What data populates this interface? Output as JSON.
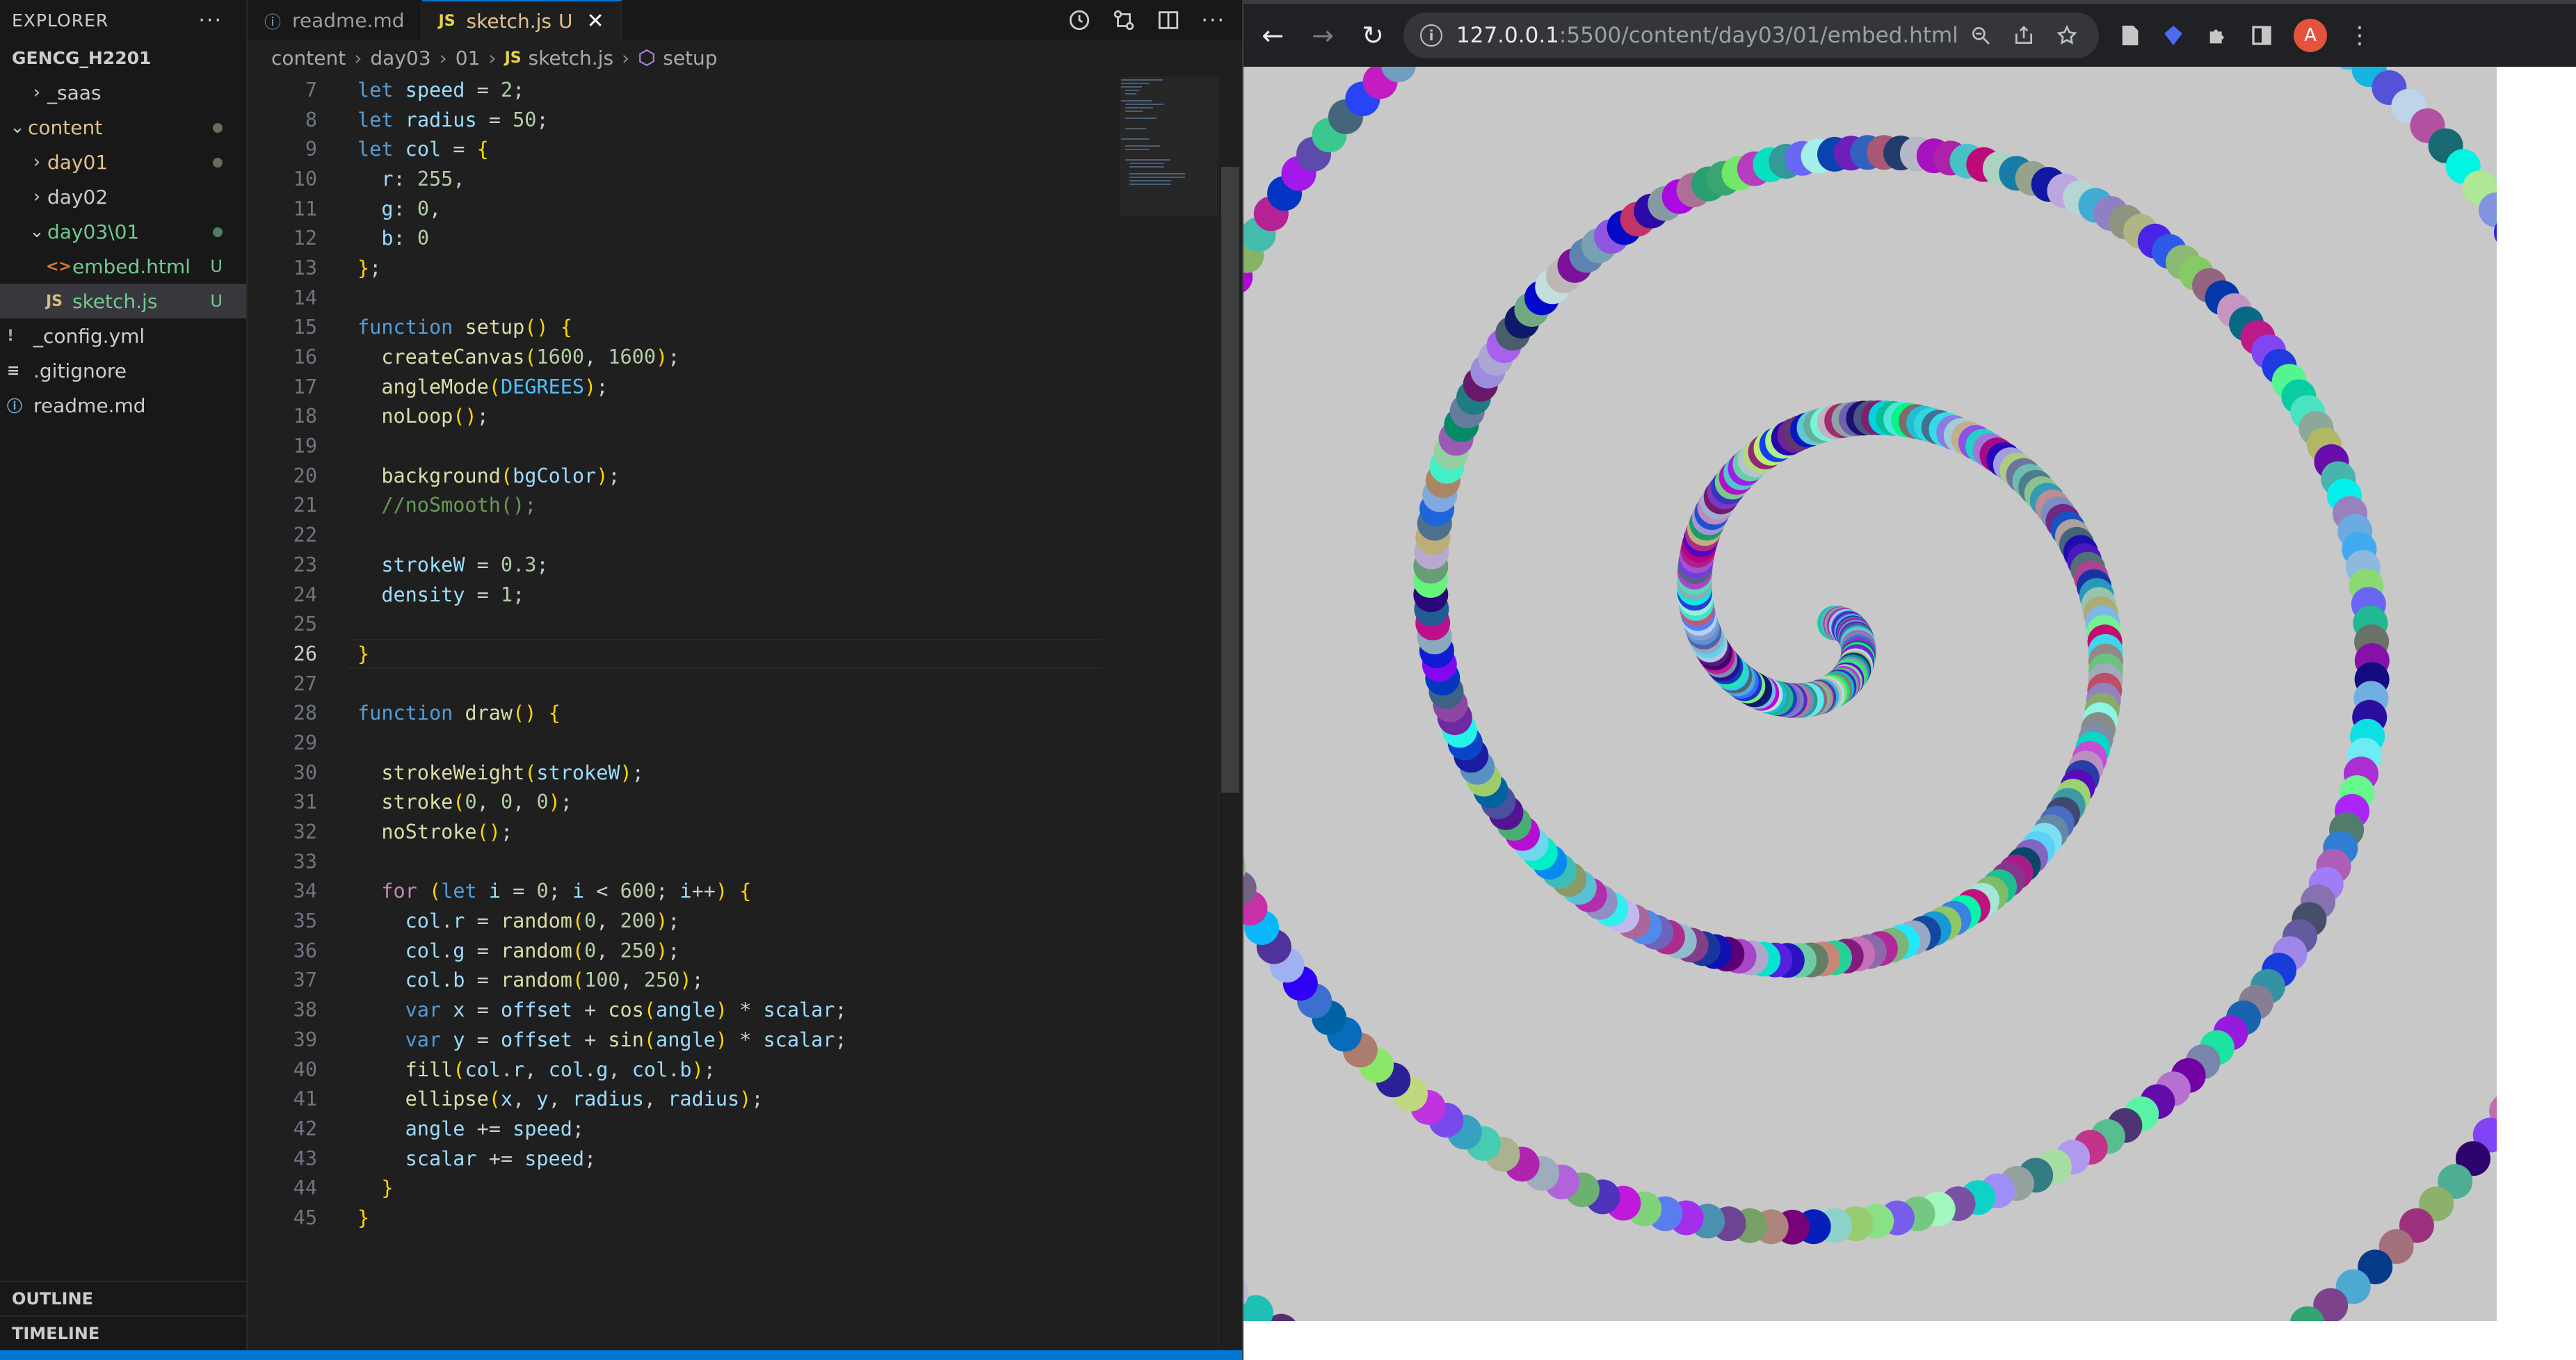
{
  "explorer": {
    "title": "EXPLORER",
    "more": "···",
    "root": "GENCG_H2201",
    "items": [
      {
        "label": "_saas",
        "chev": "›",
        "icon": "",
        "badge": ""
      },
      {
        "label": "content",
        "chev": "⌄",
        "icon": "",
        "badge": "dot"
      },
      {
        "label": "day01",
        "chev": "›",
        "icon": "",
        "badge": "dot"
      },
      {
        "label": "day02",
        "chev": "›",
        "icon": "",
        "badge": ""
      },
      {
        "label": "day03\\01",
        "chev": "⌄",
        "icon": "",
        "badge": "dot-green"
      },
      {
        "label": "embed.html",
        "chev": "",
        "icon": "<>",
        "badge": "U"
      },
      {
        "label": "sketch.js",
        "chev": "",
        "icon": "JS",
        "badge": "U"
      },
      {
        "label": "_config.yml",
        "chev": "",
        "icon": "!",
        "badge": ""
      },
      {
        "label": ".gitignore",
        "chev": "",
        "icon": "≡",
        "badge": ""
      },
      {
        "label": "readme.md",
        "chev": "",
        "icon": "ⓘ",
        "badge": ""
      }
    ],
    "outline": "OUTLINE",
    "timeline": "TIMELINE"
  },
  "tabs": [
    {
      "label": "readme.md",
      "icon": "ⓘ",
      "suffix": ""
    },
    {
      "label": "sketch.js",
      "icon": "JS",
      "suffix": "U"
    }
  ],
  "tab_close": "✕",
  "breadcrumb": [
    "content",
    "day03",
    "01",
    "sketch.js",
    "setup"
  ],
  "code_lines": [
    {
      "n": "7",
      "t": "let speed = 2;"
    },
    {
      "n": "8",
      "t": "let radius = 50;"
    },
    {
      "n": "9",
      "t": "let col = {"
    },
    {
      "n": "10",
      "t": "  r: 255,"
    },
    {
      "n": "11",
      "t": "  g: 0,"
    },
    {
      "n": "12",
      "t": "  b: 0"
    },
    {
      "n": "13",
      "t": "};"
    },
    {
      "n": "14",
      "t": ""
    },
    {
      "n": "15",
      "t": "function setup() {"
    },
    {
      "n": "16",
      "t": "  createCanvas(1600, 1600);"
    },
    {
      "n": "17",
      "t": "  angleMode(DEGREES);"
    },
    {
      "n": "18",
      "t": "  noLoop();"
    },
    {
      "n": "19",
      "t": ""
    },
    {
      "n": "20",
      "t": "  background(bgColor);"
    },
    {
      "n": "21",
      "t": "  //noSmooth();"
    },
    {
      "n": "22",
      "t": ""
    },
    {
      "n": "23",
      "t": "  strokeW = 0.3;"
    },
    {
      "n": "24",
      "t": "  density = 1;"
    },
    {
      "n": "25",
      "t": ""
    },
    {
      "n": "26",
      "t": "}"
    },
    {
      "n": "27",
      "t": ""
    },
    {
      "n": "28",
      "t": "function draw() {"
    },
    {
      "n": "29",
      "t": ""
    },
    {
      "n": "30",
      "t": "  strokeWeight(strokeW);"
    },
    {
      "n": "31",
      "t": "  stroke(0, 0, 0);"
    },
    {
      "n": "32",
      "t": "  noStroke();"
    },
    {
      "n": "33",
      "t": ""
    },
    {
      "n": "34",
      "t": "  for (let i = 0; i < 600; i++) {"
    },
    {
      "n": "35",
      "t": "    col.r = random(0, 200);"
    },
    {
      "n": "36",
      "t": "    col.g = random(0, 250);"
    },
    {
      "n": "37",
      "t": "    col.b = random(100, 250);"
    },
    {
      "n": "38",
      "t": "    var x = offset + cos(angle) * scalar;"
    },
    {
      "n": "39",
      "t": "    var y = offset + sin(angle) * scalar;"
    },
    {
      "n": "40",
      "t": "    fill(col.r, col.g, col.b);"
    },
    {
      "n": "41",
      "t": "    ellipse(x, y, radius, radius);"
    },
    {
      "n": "42",
      "t": "    angle += speed;"
    },
    {
      "n": "43",
      "t": "    scalar += speed;"
    },
    {
      "n": "44",
      "t": "  }"
    },
    {
      "n": "45",
      "t": "}"
    }
  ],
  "current_line": "26",
  "browser": {
    "url_host": "127.0.0.1",
    "url_path": ":5500/content/day03/01/embed.html",
    "avatar": "A"
  },
  "colors": {
    "accent": "#0078d4",
    "canvas_bg": "#c8c8c8"
  }
}
